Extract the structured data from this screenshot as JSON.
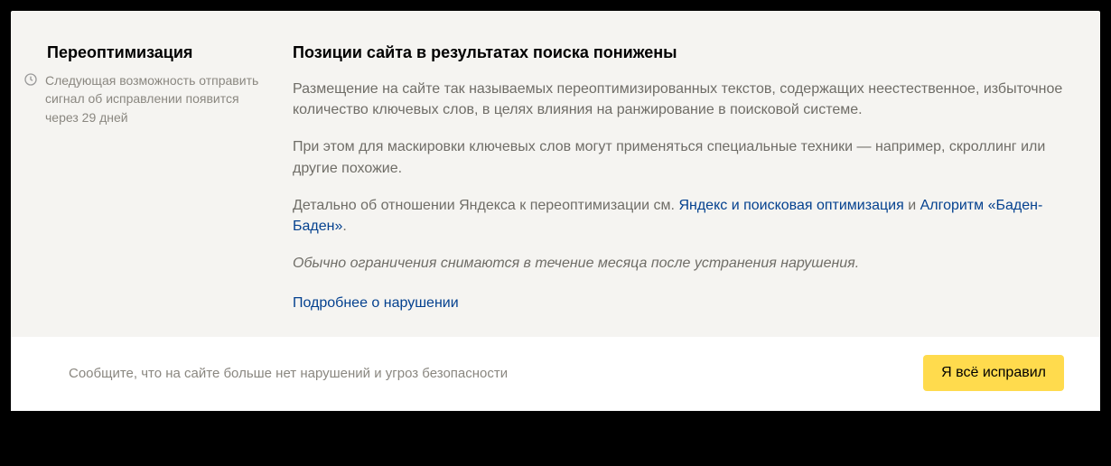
{
  "sidebar": {
    "heading": "Переоптимизация",
    "status_text": "Следующая возможность отправить сигнал об исправлении появится через 29 дней"
  },
  "main": {
    "subtitle": "Позиции сайта в результатах поиска понижены",
    "para1": "Размещение на сайте так называемых переоптимизированных текстов, содержащих неестественное, избыточное количество ключевых слов, в целях влияния на ранжирование в поисковой системе.",
    "para2": "При этом для маскировки ключевых слов могут применяться специальные техники — например, скроллинг или другие похожие.",
    "para3_pre": "Детально об отношении Яндекса к переоптимизации см. ",
    "link1": "Яндекс и поисковая оптимизация",
    "para3_mid": " и ",
    "link2": "Алгоритм «Баден-Баден»",
    "para3_post": ".",
    "para4": "Обычно ограничения снимаются в течение месяца после устранения нарушения.",
    "more_link": "Подробнее о нарушении"
  },
  "footer": {
    "message": "Сообщите, что на сайте больше нет нарушений и угроз безопасности",
    "button": "Я всё исправил"
  }
}
